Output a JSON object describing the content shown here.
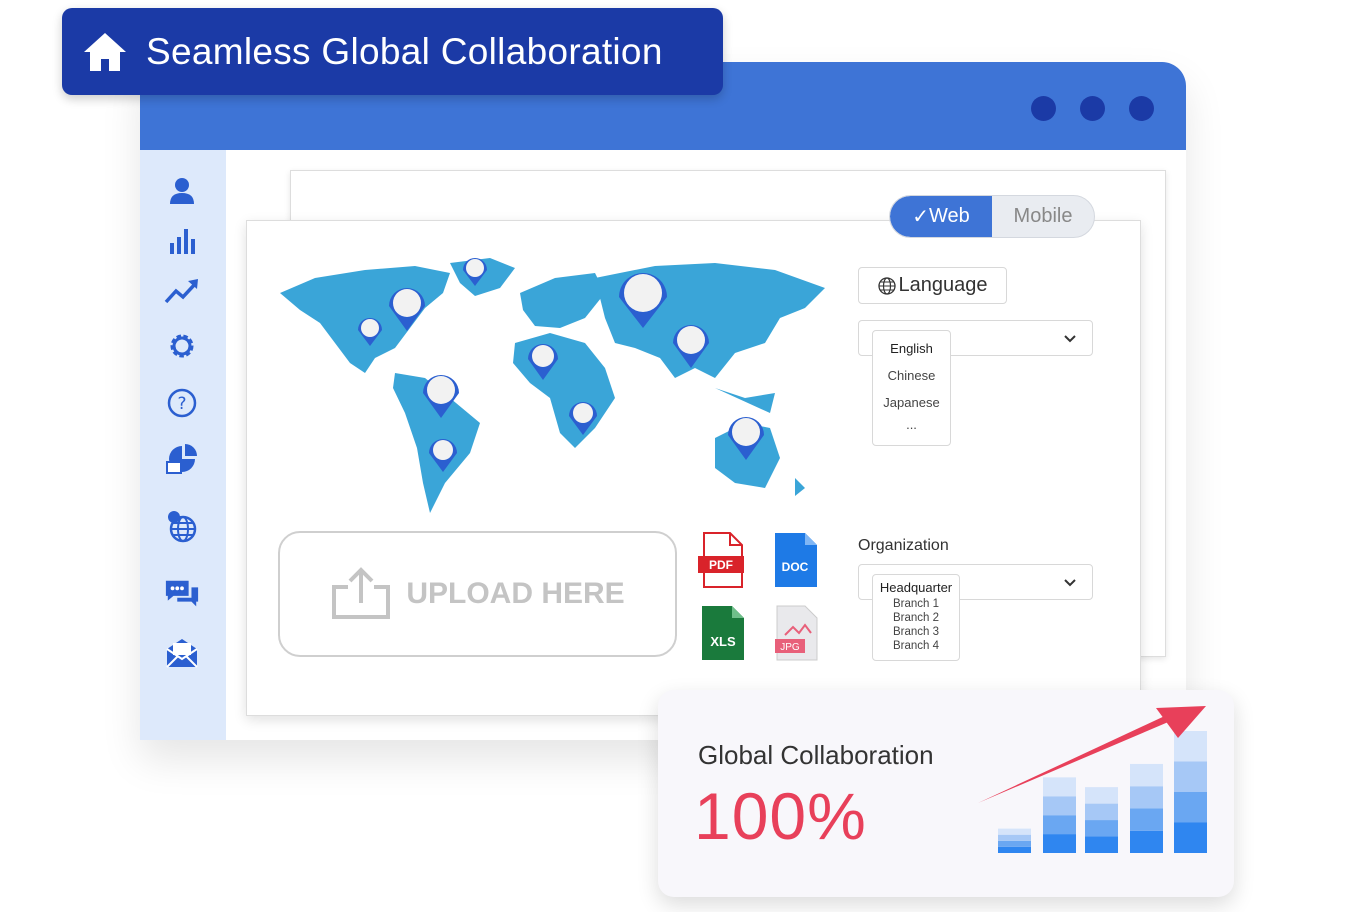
{
  "banner": {
    "title": "Seamless Global Collaboration",
    "icon": "home-icon"
  },
  "window": {
    "header_color": "#3e74d6",
    "dots": 3
  },
  "sidebar": {
    "items": [
      {
        "icon": "user-icon"
      },
      {
        "icon": "bar-chart-icon"
      },
      {
        "icon": "trend-up-icon"
      },
      {
        "icon": "gear-icon"
      },
      {
        "icon": "help-icon"
      },
      {
        "icon": "pie-chart-icon"
      },
      {
        "icon": "globe-network-icon"
      },
      {
        "icon": "chat-icon"
      },
      {
        "icon": "mail-icon"
      }
    ]
  },
  "view_toggle": {
    "options": [
      "Web",
      "Mobile"
    ],
    "selected": "Web"
  },
  "upload": {
    "label": "UPLOAD HERE"
  },
  "files": [
    {
      "type": "PDF",
      "color": "#d9232a"
    },
    {
      "type": "DOC",
      "color": "#1e7ae6"
    },
    {
      "type": "XLS",
      "color": "#1a7a3c"
    },
    {
      "type": "JPG",
      "color": "#e8607a"
    }
  ],
  "language": {
    "button_label": "Language",
    "options": [
      "English",
      "Chinese",
      "Japanese",
      "..."
    ],
    "selected": "English"
  },
  "organization": {
    "label": "Organization",
    "options": [
      "Headquarter",
      "Branch 1",
      "Branch 2",
      "Branch 3",
      "Branch 4"
    ],
    "selected": "Headquarter"
  },
  "stat": {
    "title": "Global Collaboration",
    "value": "100%",
    "accent": "#e8405a",
    "bar_levels": [
      0.2,
      0.62,
      0.54,
      0.73,
      1.0
    ]
  }
}
